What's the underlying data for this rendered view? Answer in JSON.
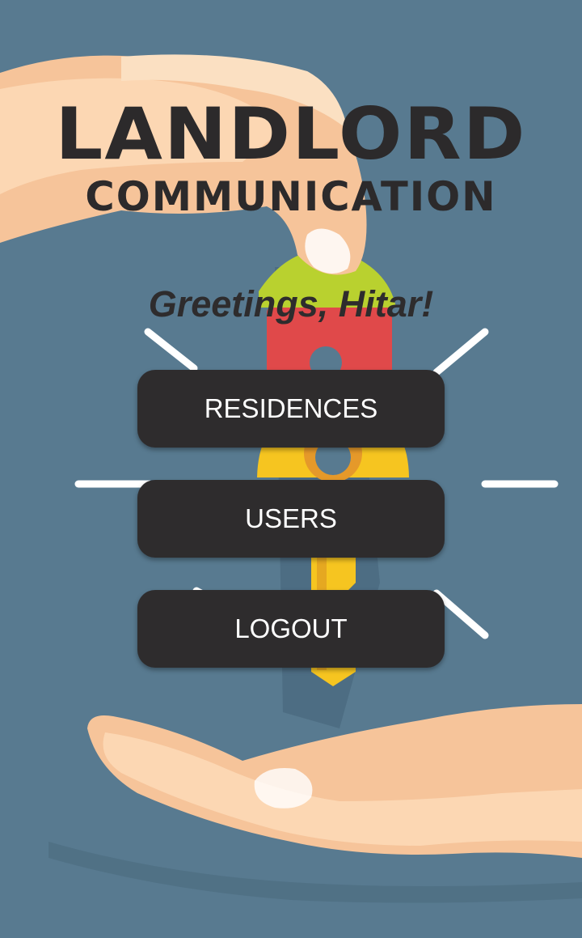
{
  "app": {
    "logo_line1": "LANDLORD",
    "logo_line2": "COMMUNICATION"
  },
  "greeting": "Greetings, Hitar!",
  "menu": {
    "residences_label": "RESIDENCES",
    "users_label": "USERS",
    "logout_label": "LOGOUT"
  },
  "colors": {
    "background": "#587a90",
    "button": "#2e2c2d",
    "button_text": "#ffffff",
    "logo_text": "#2c2a2b"
  },
  "icons": {
    "background": "hands-passing-house-key-illustration"
  }
}
